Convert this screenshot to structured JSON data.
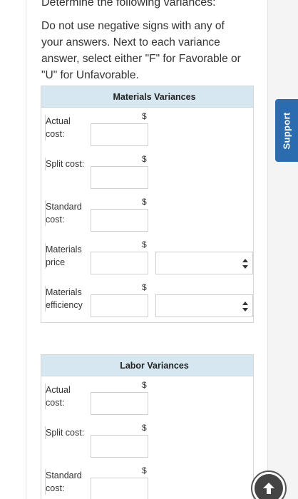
{
  "heading": "Determine the following variances:",
  "instructions": "Do not use negative signs with any of your answers. Next to each variance answer, select either \"F\" for Favorable or \"U\" for Unfavorable.",
  "materials": {
    "title": "Materials Variances",
    "rows": [
      {
        "label": "Actual cost:",
        "currency": "$",
        "value": "",
        "has_select": false
      },
      {
        "label": "Split cost:",
        "currency": "$",
        "value": "",
        "has_select": false
      },
      {
        "label": "Standard cost:",
        "currency": "$",
        "value": "",
        "has_select": false
      },
      {
        "label": "Materials price",
        "currency": "$",
        "value": "",
        "has_select": true,
        "select_value": ""
      },
      {
        "label": "Materials efficiency",
        "currency": "$",
        "value": "",
        "has_select": true,
        "select_value": ""
      }
    ]
  },
  "labor": {
    "title": "Labor Variances",
    "rows": [
      {
        "label": "Actual cost:",
        "currency": "$",
        "value": "",
        "has_select": false
      },
      {
        "label": "Split cost:",
        "currency": "$",
        "value": "",
        "has_select": false
      },
      {
        "label": "Standard cost:",
        "currency": "$",
        "value": "",
        "has_select": false
      }
    ]
  },
  "support": {
    "label": "Support"
  },
  "colors": {
    "header_bg": "#d7e7f1",
    "support_bg": "#2b6cb0"
  }
}
